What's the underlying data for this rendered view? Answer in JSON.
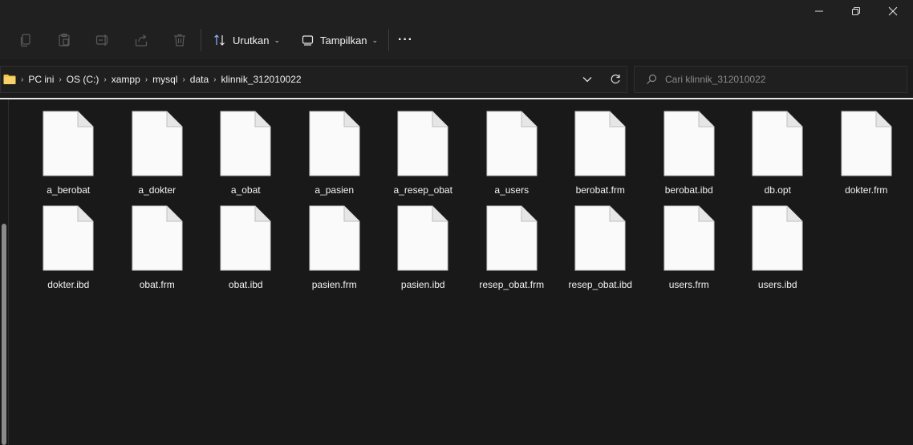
{
  "window": {
    "controls": [
      {
        "name": "minimize-icon",
        "glyph": "—"
      },
      {
        "name": "restore-icon",
        "glyph": "❐"
      },
      {
        "name": "close-icon",
        "glyph": "✕"
      }
    ]
  },
  "toolbar": {
    "sort_label": "Urutkan",
    "view_label": "Tampilkan",
    "more_label": "···",
    "icons": [
      "copy-icon",
      "paste-icon",
      "rename-icon",
      "share-icon",
      "delete-icon"
    ]
  },
  "address": {
    "crumbs": [
      "PC ini",
      "OS (C:)",
      "xampp",
      "mysql",
      "data",
      "klinnik_312010022"
    ],
    "separator": "›"
  },
  "search": {
    "placeholder": "Cari klinnik_312010022"
  },
  "files": [
    {
      "name": "a_berobat"
    },
    {
      "name": "a_dokter"
    },
    {
      "name": "a_obat"
    },
    {
      "name": "a_pasien"
    },
    {
      "name": "a_resep_obat"
    },
    {
      "name": "a_users"
    },
    {
      "name": "berobat.frm"
    },
    {
      "name": "berobat.ibd"
    },
    {
      "name": "db.opt"
    },
    {
      "name": "dokter.frm"
    },
    {
      "name": "dokter.ibd"
    },
    {
      "name": "obat.frm"
    },
    {
      "name": "obat.ibd"
    },
    {
      "name": "pasien.frm"
    },
    {
      "name": "pasien.ibd"
    },
    {
      "name": "resep_obat.frm"
    },
    {
      "name": "resep_obat.ibd"
    },
    {
      "name": "users.frm"
    },
    {
      "name": "users.ibd"
    }
  ],
  "colors": {
    "background": "#191919",
    "toolbar": "#202020",
    "folder": "#f3c342",
    "file_icon": "#fafafa"
  }
}
